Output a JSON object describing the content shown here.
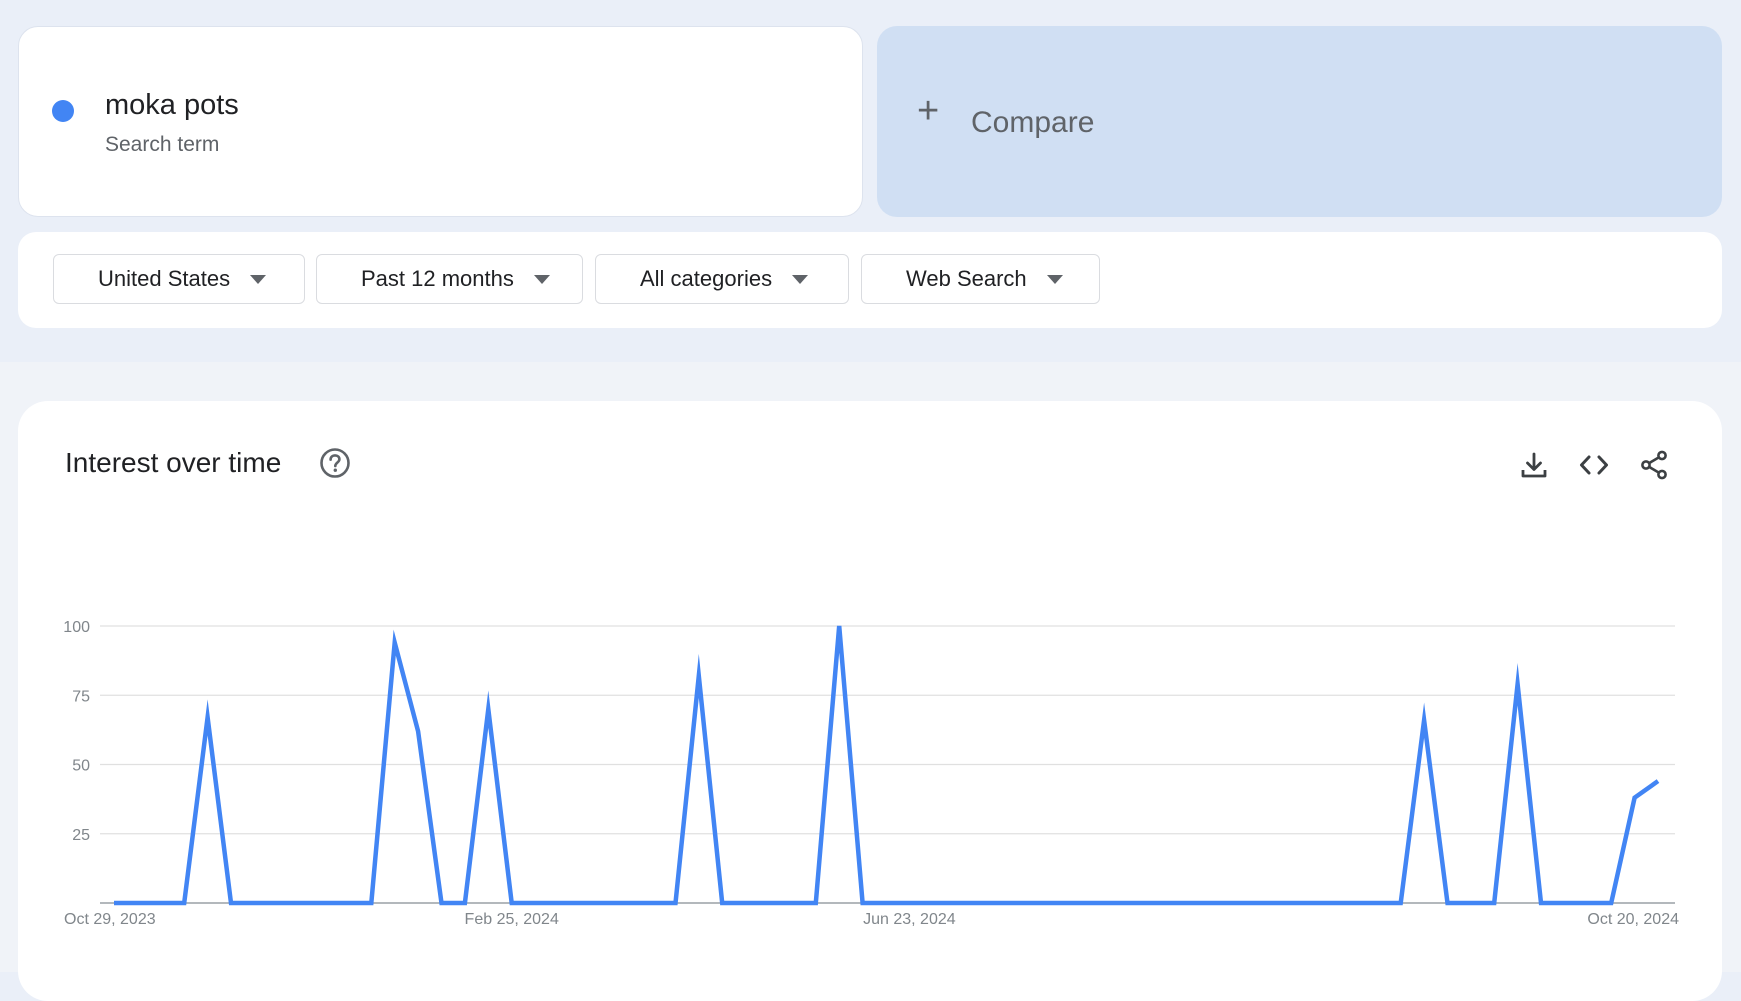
{
  "search_term": {
    "name": "moka pots",
    "subtitle": "Search term",
    "color": "#4285f4"
  },
  "compare": {
    "icon": "plus-icon",
    "label": "Compare"
  },
  "filters": [
    {
      "label": "United States"
    },
    {
      "label": "Past 12 months"
    },
    {
      "label": "All categories"
    },
    {
      "label": "Web Search"
    }
  ],
  "chart_section": {
    "title": "Interest over time",
    "icons": [
      "help-icon",
      "download-icon",
      "embed-code-icon",
      "share-icon"
    ]
  },
  "chart_data": {
    "type": "line",
    "x_tick_labels": [
      "Oct 29, 2023",
      "Feb 25, 2024",
      "Jun 23, 2024",
      "Oct 20, 2024"
    ],
    "y_tick_labels": [
      "100",
      "75",
      "50",
      "25"
    ],
    "ylim": [
      0,
      100
    ],
    "yticks": [
      0,
      25,
      50,
      75,
      100
    ],
    "grid": true,
    "legend": "none",
    "series": [
      {
        "color": "#4285f4",
        "values": [
          0,
          0,
          0,
          0,
          67,
          0,
          0,
          0,
          0,
          0,
          0,
          0,
          94,
          62,
          0,
          0,
          70,
          0,
          0,
          0,
          0,
          0,
          0,
          0,
          0,
          82,
          0,
          0,
          0,
          0,
          0,
          100,
          0,
          0,
          0,
          0,
          0,
          0,
          0,
          0,
          0,
          0,
          0,
          0,
          0,
          0,
          0,
          0,
          0,
          0,
          0,
          0,
          0,
          0,
          0,
          0,
          66,
          0,
          0,
          0,
          79,
          0,
          0,
          0,
          0,
          38,
          44
        ]
      }
    ]
  }
}
